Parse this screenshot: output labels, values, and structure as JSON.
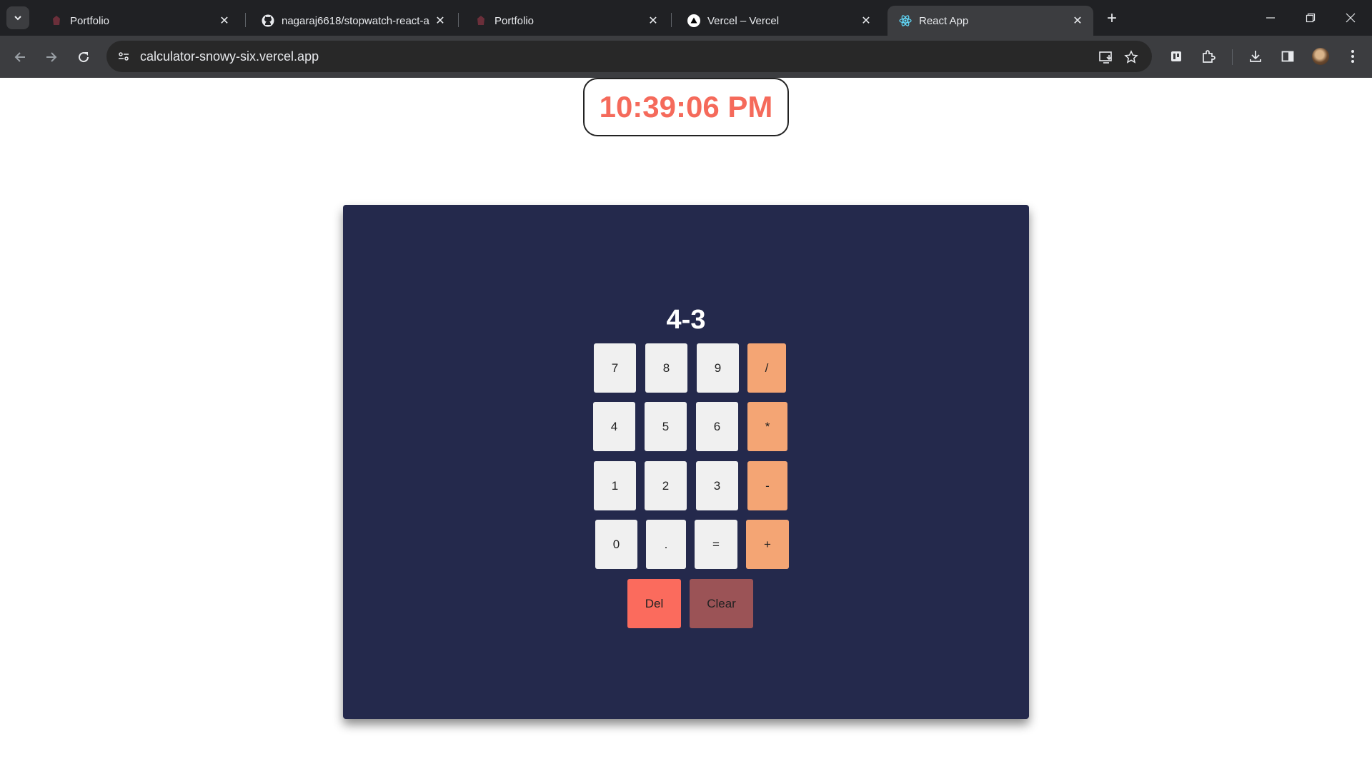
{
  "browser": {
    "tabs": [
      {
        "title": "Portfolio",
        "icon": "portfolio-favicon"
      },
      {
        "title": "nagaraj6618/stopwatch-react-a",
        "icon": "github-icon"
      },
      {
        "title": "Portfolio",
        "icon": "portfolio-favicon"
      },
      {
        "title": "Vercel – Vercel",
        "icon": "vercel-icon"
      },
      {
        "title": "React App",
        "icon": "react-icon",
        "active": true
      }
    ],
    "url": "calculator-snowy-six.vercel.app"
  },
  "clock": {
    "time": "10:39:06 PM"
  },
  "calculator": {
    "display": "4-3",
    "keys": {
      "k7": "7",
      "k8": "8",
      "k9": "9",
      "div": "/",
      "k4": "4",
      "k5": "5",
      "k6": "6",
      "mul": "*",
      "k1": "1",
      "k2": "2",
      "k3": "3",
      "sub": "-",
      "k0": "0",
      "dot": ".",
      "eq": "=",
      "add": "+",
      "del": "Del",
      "clear": "Clear"
    }
  },
  "colors": {
    "clock_text": "#f56a5b",
    "panel": "#24294c",
    "digit_key": "#f0f0f0",
    "operator_key": "#f4a574",
    "del_key": "#fb6b5d",
    "clear_key": "#9b5356"
  }
}
